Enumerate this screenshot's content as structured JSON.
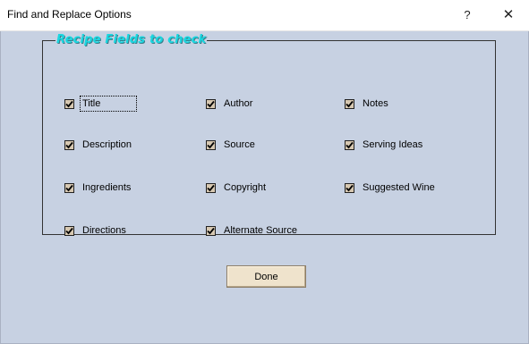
{
  "window": {
    "title": "Find and Replace Options",
    "help_label": "?",
    "close_label": "✕"
  },
  "group": {
    "legend": "Recipe Fields to check",
    "fields": [
      {
        "label": "Title",
        "checked": true
      },
      {
        "label": "Author",
        "checked": true
      },
      {
        "label": "Notes",
        "checked": true
      },
      {
        "label": "Description",
        "checked": true
      },
      {
        "label": "Source",
        "checked": true
      },
      {
        "label": "Serving Ideas",
        "checked": true
      },
      {
        "label": "Ingredients",
        "checked": true
      },
      {
        "label": "Copyright",
        "checked": true
      },
      {
        "label": "Suggested Wine",
        "checked": true
      },
      {
        "label": "Directions",
        "checked": true
      },
      {
        "label": "Alternate Source",
        "checked": true
      }
    ]
  },
  "buttons": {
    "done_label": "Done"
  },
  "colors": {
    "client_bg": "#c7d1e2",
    "legend_text": "#19d7e0",
    "checkbox_bg": "#d7c8b1",
    "button_bg": "#efe3cc"
  }
}
